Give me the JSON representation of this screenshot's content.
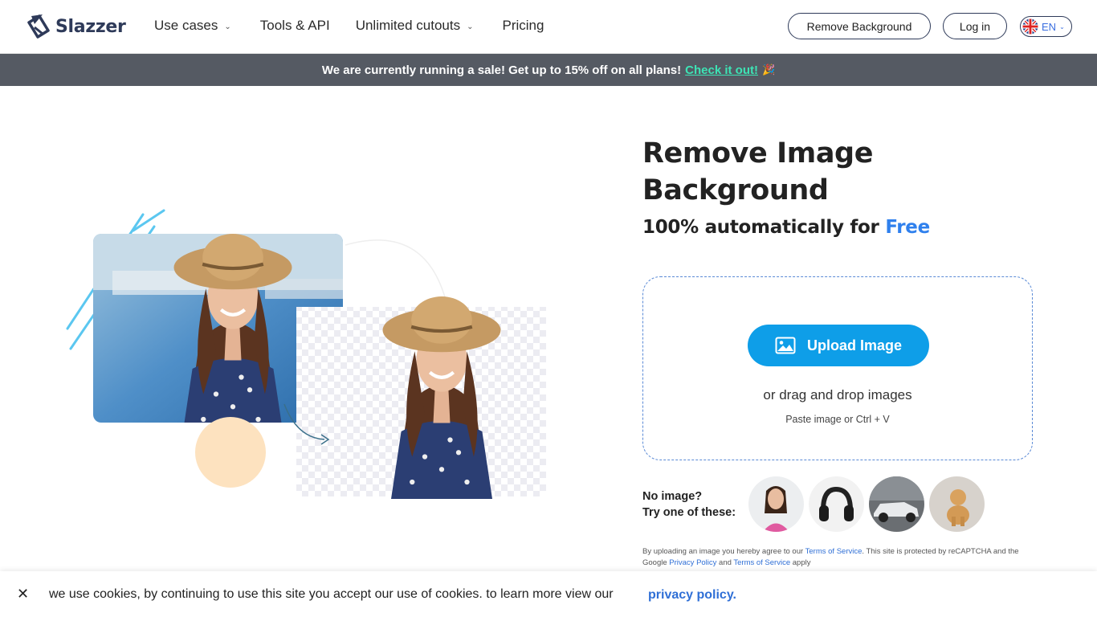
{
  "header": {
    "logo_text": "Slazzer",
    "nav": [
      {
        "label": "Use cases",
        "has_dropdown": true
      },
      {
        "label": "Tools & API",
        "has_dropdown": false
      },
      {
        "label": "Unlimited cutouts",
        "has_dropdown": true
      },
      {
        "label": "Pricing",
        "has_dropdown": false
      }
    ],
    "remove_bg_label": "Remove Background",
    "login_label": "Log in",
    "language": "EN"
  },
  "banner": {
    "text": "We are currently running a sale! Get up to 15% off on all plans!",
    "link": "Check it out!",
    "emoji": "🎉"
  },
  "hero": {
    "title": "Remove Image Background",
    "subtitle_prefix": "100% automatically for",
    "subtitle_highlight": "Free"
  },
  "upload": {
    "button_label": "Upload Image",
    "drag_text": "or drag and drop images",
    "paste_text": "Paste image or Ctrl + V"
  },
  "samples": {
    "label_line1": "No image?",
    "label_line2": "Try one of these:"
  },
  "terms": {
    "p1": "By uploading an image you hereby agree to our",
    "tos": "Terms of Service",
    "p2": ". This site is protected by reCAPTCHA and the Google",
    "privacy": "Privacy Policy",
    "p3": "and",
    "tos2": "Terms of Service",
    "p4": "apply"
  },
  "cookie": {
    "close": "✕",
    "text": "we use cookies, by continuing to use this site you accept our use of cookies. to learn more view our",
    "link": "privacy policy."
  },
  "colors": {
    "brand": "#2e3a59",
    "accent_blue": "#0e9ee8",
    "free_blue": "#2f80ed",
    "banner_bg": "#555a63",
    "banner_link": "#3de4b5"
  }
}
